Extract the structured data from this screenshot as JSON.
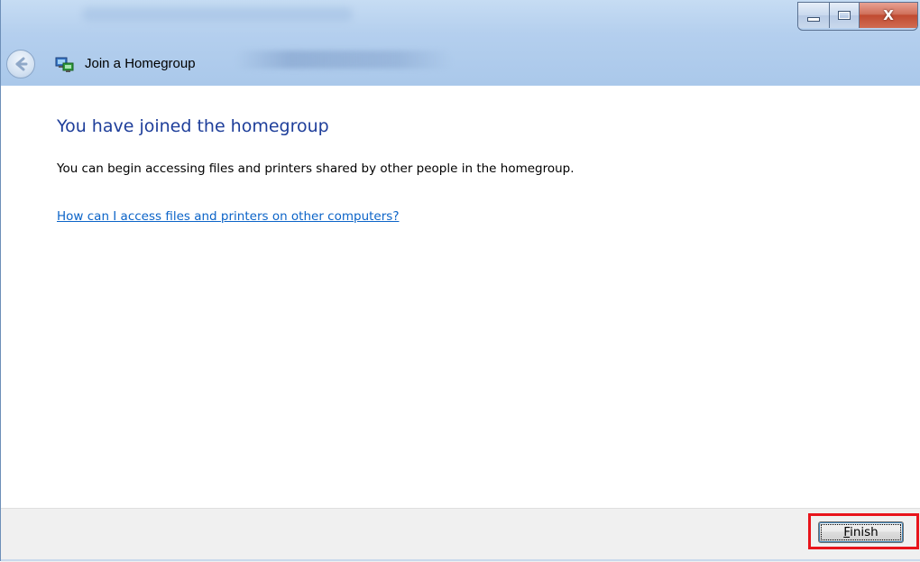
{
  "window": {
    "controls": {
      "minimize_icon": "minimize-icon",
      "maximize_icon": "maximize-icon",
      "close_label": "X"
    }
  },
  "nav": {
    "back_icon": "back-arrow-icon",
    "app_icon": "homegroup-icon",
    "title": "Join a Homegroup"
  },
  "main": {
    "heading": "You have joined the homegroup",
    "description": "You can begin accessing files and printers shared by other people in the homegroup.",
    "help_link": "How can I access files and printers on other computers?"
  },
  "footer": {
    "finish_label": "Finish",
    "finish_access_key": "F"
  },
  "colors": {
    "heading": "#1e3e9a",
    "link": "#0c64c8",
    "highlight": "#e8141b",
    "titlebar": "#b4cfee"
  }
}
